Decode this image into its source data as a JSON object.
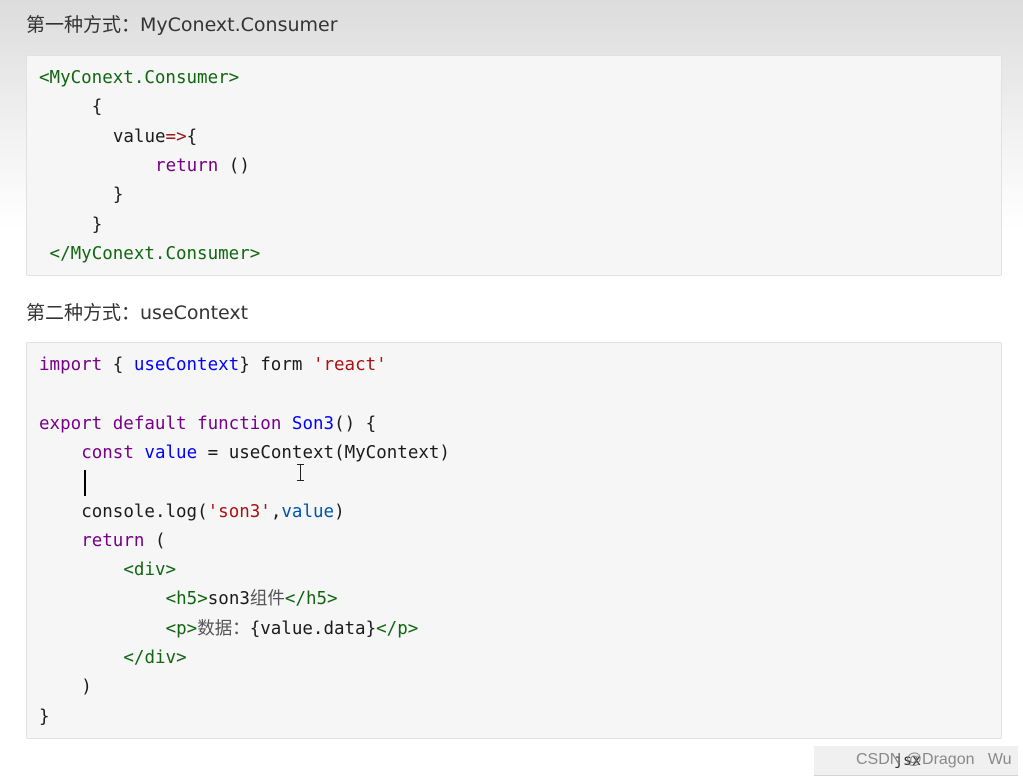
{
  "section1": {
    "heading": "第一种方式：MyConext.Consumer",
    "code_lines": [
      {
        "indent": 0,
        "tokens": [
          {
            "t": "<MyConext.Consumer>",
            "c": "c-tag"
          }
        ]
      },
      {
        "indent": 5,
        "tokens": [
          {
            "t": "{",
            "c": "c-def"
          }
        ]
      },
      {
        "indent": 7,
        "tokens": [
          {
            "t": "value",
            "c": "c-def"
          },
          {
            "t": "=>",
            "c": "c-op"
          },
          {
            "t": "{",
            "c": "c-def"
          }
        ]
      },
      {
        "indent": 11,
        "tokens": [
          {
            "t": "return",
            "c": "c-kw"
          },
          {
            "t": " ()",
            "c": "c-def"
          }
        ]
      },
      {
        "indent": 7,
        "tokens": [
          {
            "t": "}",
            "c": "c-def"
          }
        ]
      },
      {
        "indent": 5,
        "tokens": [
          {
            "t": "}",
            "c": "c-def"
          }
        ]
      },
      {
        "indent": 1,
        "tokens": [
          {
            "t": "</MyConext.Consumer>",
            "c": "c-tag"
          }
        ]
      }
    ]
  },
  "section2": {
    "heading": "第二种方式：useContext",
    "code_lines": [
      {
        "indent": 0,
        "tokens": [
          {
            "t": "import",
            "c": "c-kw"
          },
          {
            "t": " { ",
            "c": "c-def"
          },
          {
            "t": "useContext",
            "c": "c-fn"
          },
          {
            "t": "} form ",
            "c": "c-def"
          },
          {
            "t": "'react'",
            "c": "c-str"
          }
        ]
      },
      {
        "indent": 0,
        "tokens": []
      },
      {
        "indent": 0,
        "tokens": [
          {
            "t": "export",
            "c": "c-kw"
          },
          {
            "t": " ",
            "c": "c-def"
          },
          {
            "t": "default",
            "c": "c-kw"
          },
          {
            "t": " ",
            "c": "c-def"
          },
          {
            "t": "function",
            "c": "c-kw"
          },
          {
            "t": " ",
            "c": "c-def"
          },
          {
            "t": "Son3",
            "c": "c-fn"
          },
          {
            "t": "() {",
            "c": "c-def"
          }
        ]
      },
      {
        "indent": 4,
        "tokens": [
          {
            "t": "const",
            "c": "c-kw"
          },
          {
            "t": " ",
            "c": "c-def"
          },
          {
            "t": "value",
            "c": "c-fn"
          },
          {
            "t": " = useContext(MyContext)",
            "c": "c-def"
          }
        ]
      },
      {
        "indent": 4,
        "tokens": []
      },
      {
        "indent": 4,
        "tokens": [
          {
            "t": "console.log(",
            "c": "c-def"
          },
          {
            "t": "'son3'",
            "c": "c-str"
          },
          {
            "t": ",",
            "c": "c-def"
          },
          {
            "t": "value",
            "c": "c-var"
          },
          {
            "t": ")",
            "c": "c-def"
          }
        ]
      },
      {
        "indent": 4,
        "tokens": [
          {
            "t": "return",
            "c": "c-kw"
          },
          {
            "t": " (",
            "c": "c-def"
          }
        ]
      },
      {
        "indent": 8,
        "tokens": [
          {
            "t": "<div>",
            "c": "c-tag"
          }
        ]
      },
      {
        "indent": 12,
        "tokens": [
          {
            "t": "<h5>",
            "c": "c-tag"
          },
          {
            "t": "son3",
            "c": "c-def"
          },
          {
            "t": "组件",
            "c": "c-cn"
          },
          {
            "t": "</h5>",
            "c": "c-tag"
          }
        ]
      },
      {
        "indent": 12,
        "tokens": [
          {
            "t": "<p>",
            "c": "c-tag"
          },
          {
            "t": "数据：",
            "c": "c-cn"
          },
          {
            "t": "{value.data}",
            "c": "c-def"
          },
          {
            "t": "</p>",
            "c": "c-tag"
          }
        ]
      },
      {
        "indent": 8,
        "tokens": [
          {
            "t": "</div>",
            "c": "c-tag"
          }
        ]
      },
      {
        "indent": 4,
        "tokens": [
          {
            "t": ")",
            "c": "c-def"
          }
        ]
      },
      {
        "indent": 0,
        "tokens": [
          {
            "t": "}",
            "c": "c-def"
          }
        ]
      }
    ]
  },
  "code_language": "jsx",
  "watermark": "CSDN @Dragon   Wu",
  "colors": {
    "tag": "#116611",
    "keyword": "#770088",
    "function": "#0000ff",
    "string": "#aa1111",
    "variable": "#0055aa",
    "code_bg": "#f6f6f6"
  },
  "icons": [
    "text-cursor-icon",
    "ibeam-pointer-icon"
  ]
}
